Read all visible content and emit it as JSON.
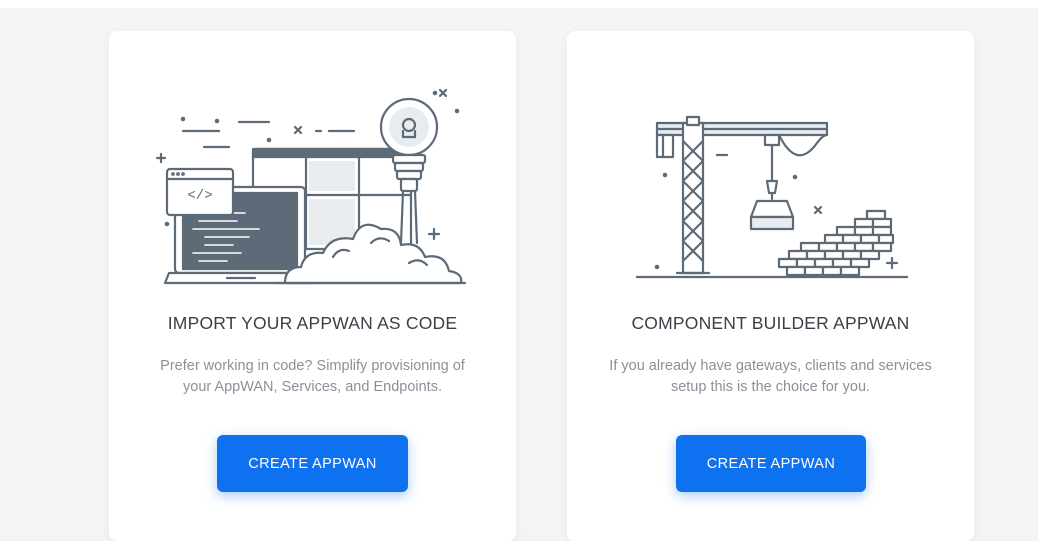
{
  "cards": [
    {
      "title": "IMPORT YOUR APPWAN AS CODE",
      "description": "Prefer working in code? Simplify provisioning of your AppWAN, Services, and Endpoints.",
      "button_label": "CREATE APPWAN",
      "illustration_icon": "code-import-illustration-icon",
      "illustration_code_tag": "</>"
    },
    {
      "title": "COMPONENT BUILDER APPWAN",
      "description": "If you already have gateways, clients and services setup this is the choice for you.",
      "button_label": "CREATE APPWAN",
      "illustration_icon": "crane-builder-illustration-icon"
    }
  ],
  "colors": {
    "accent": "#0e72f0",
    "illustration_stroke": "#5d6b78",
    "illustration_fill": "#e8ecef",
    "title": "#3b3f48",
    "description": "#8b909a"
  }
}
